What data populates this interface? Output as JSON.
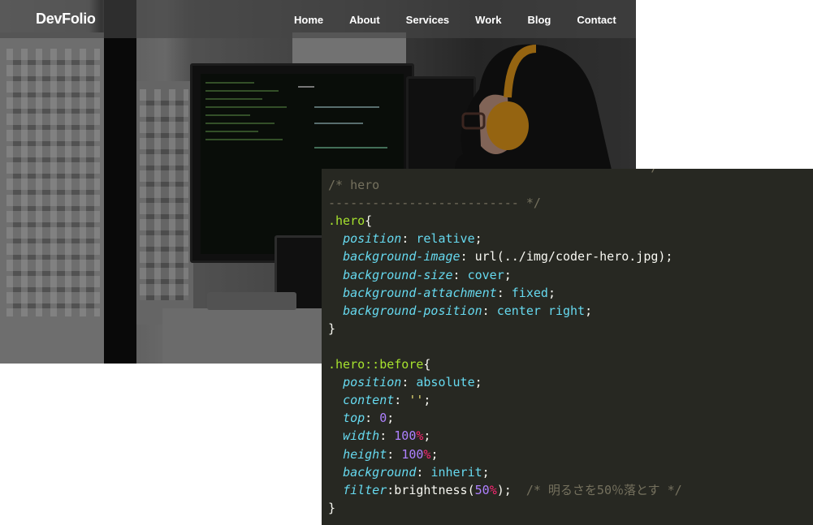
{
  "site": {
    "logo": "DevFolio",
    "nav": [
      {
        "label": "Home"
      },
      {
        "label": "About"
      },
      {
        "label": "Services"
      },
      {
        "label": "Work"
      },
      {
        "label": "Blog"
      },
      {
        "label": "Contact"
      }
    ]
  },
  "hero": {
    "image": "woman-with-orange-headphones-at-code-monitors",
    "headphones_color": "#e59a1b"
  },
  "code": {
    "theme": {
      "background": "#272822",
      "comment": "#75715e",
      "selector": "#a6e22e",
      "property": "#66d9ef",
      "number": "#ae81ff",
      "unit": "#f92672",
      "string": "#e6db74"
    },
    "lines": [
      "------------------------------------------ */",
      "/* hero",
      "-------------------------- */",
      ".hero{",
      "  position: relative;",
      "  background-image: url(../img/coder-hero.jpg);",
      "  background-size: cover;",
      "  background-attachment: fixed;",
      "  background-position: center right;",
      "}",
      "",
      ".hero::before{",
      "  position: absolute;",
      "  content: '';",
      "  top: 0;",
      "  width: 100%;",
      "  height: 100%;",
      "  background: inherit;",
      "  filter:brightness(50%);  /* 明るさを50％落とす */",
      "}"
    ]
  }
}
